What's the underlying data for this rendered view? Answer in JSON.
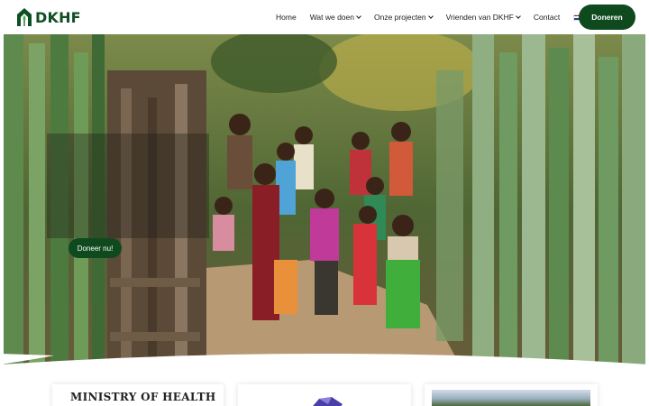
{
  "header": {
    "logo_text": "DKHF",
    "nav": [
      {
        "label": "Home",
        "has_dropdown": false
      },
      {
        "label": "Wat we doen",
        "has_dropdown": true
      },
      {
        "label": "Onze projecten",
        "has_dropdown": true
      },
      {
        "label": "Vrienden van DKHF",
        "has_dropdown": true
      },
      {
        "label": "Contact",
        "has_dropdown": false
      }
    ],
    "language_flag": "netherlands-flag-icon",
    "donate_label": "Doneren"
  },
  "hero": {
    "cta_label": "Doneer nu!"
  },
  "cards": [
    {
      "type": "logo",
      "text": "MINISTRY OF HEALTH"
    },
    {
      "type": "logo",
      "icon": "partner-logo-icon"
    },
    {
      "type": "photo",
      "icon": "partner-photo"
    }
  ],
  "colors": {
    "brand_green": "#0f4a1f",
    "flag_red": "#ae1c28",
    "flag_white": "#ffffff",
    "flag_blue": "#21468b"
  }
}
